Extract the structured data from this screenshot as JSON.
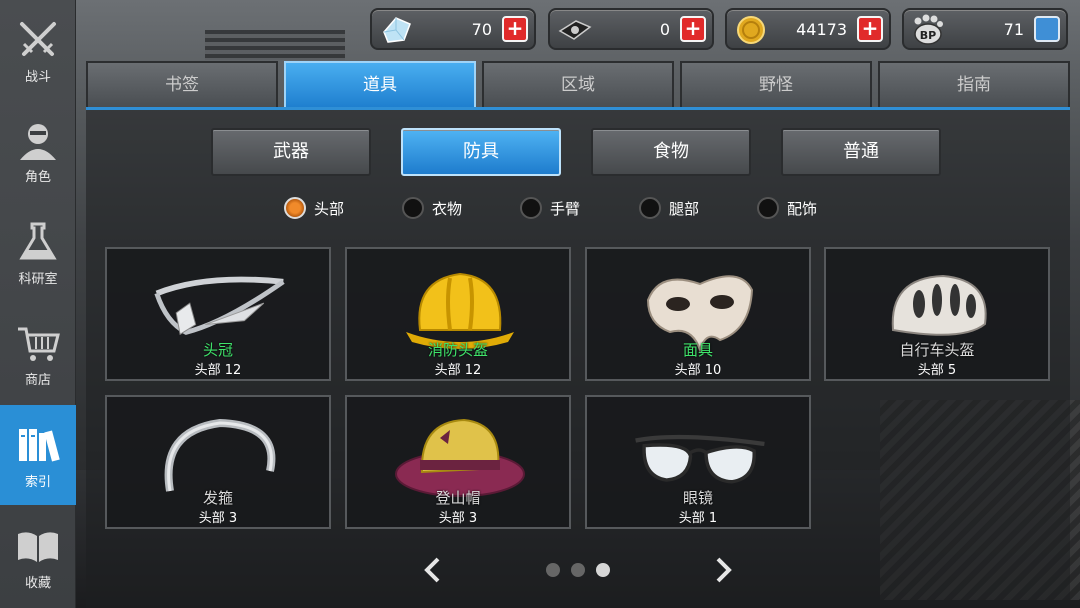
{
  "sidebar": {
    "items": [
      {
        "label": "战斗",
        "icon": "crossed-swords-icon"
      },
      {
        "label": "角色",
        "icon": "character-icon"
      },
      {
        "label": "科研室",
        "icon": "flask-icon"
      },
      {
        "label": "商店",
        "icon": "cart-icon"
      },
      {
        "label": "索引",
        "icon": "books-icon",
        "active": true
      },
      {
        "label": "收藏",
        "icon": "open-book-icon"
      }
    ]
  },
  "resources": [
    {
      "icon": "crystal-icon",
      "value": "70"
    },
    {
      "icon": "data-disk-icon",
      "value": "0"
    },
    {
      "icon": "coin-icon",
      "value": "44173"
    },
    {
      "icon": "bp-paw-icon",
      "value": "71"
    }
  ],
  "tabs": [
    {
      "label": "书签"
    },
    {
      "label": "道具",
      "active": true
    },
    {
      "label": "区域"
    },
    {
      "label": "野怪"
    },
    {
      "label": "指南"
    }
  ],
  "subtabs": [
    {
      "label": "武器"
    },
    {
      "label": "防具",
      "active": true
    },
    {
      "label": "食物"
    },
    {
      "label": "普通"
    }
  ],
  "filters": [
    {
      "label": "头部",
      "active": true
    },
    {
      "label": "衣物"
    },
    {
      "label": "手臂"
    },
    {
      "label": "腿部"
    },
    {
      "label": "配饰"
    }
  ],
  "items": [
    {
      "name": "头冠",
      "sub": "头部 12",
      "new": true,
      "icon": "tiara-icon"
    },
    {
      "name": "消防头盔",
      "sub": "头部 12",
      "new": true,
      "icon": "hard-hat-icon"
    },
    {
      "name": "面具",
      "sub": "头部 10",
      "new": true,
      "icon": "mask-icon"
    },
    {
      "name": "自行车头盔",
      "sub": "头部 5",
      "new": false,
      "icon": "bike-helmet-icon"
    },
    {
      "name": "发箍",
      "sub": "头部 3",
      "new": false,
      "icon": "headband-icon"
    },
    {
      "name": "登山帽",
      "sub": "头部 3",
      "new": false,
      "icon": "hiking-hat-icon"
    },
    {
      "name": "眼镜",
      "sub": "头部 1",
      "new": false,
      "icon": "glasses-icon"
    }
  ],
  "pager": {
    "pages": 3,
    "current": 3
  },
  "colors": {
    "accent": "#2a8fd6",
    "new_item": "#3fe36a",
    "plus": "#e12a2a"
  }
}
